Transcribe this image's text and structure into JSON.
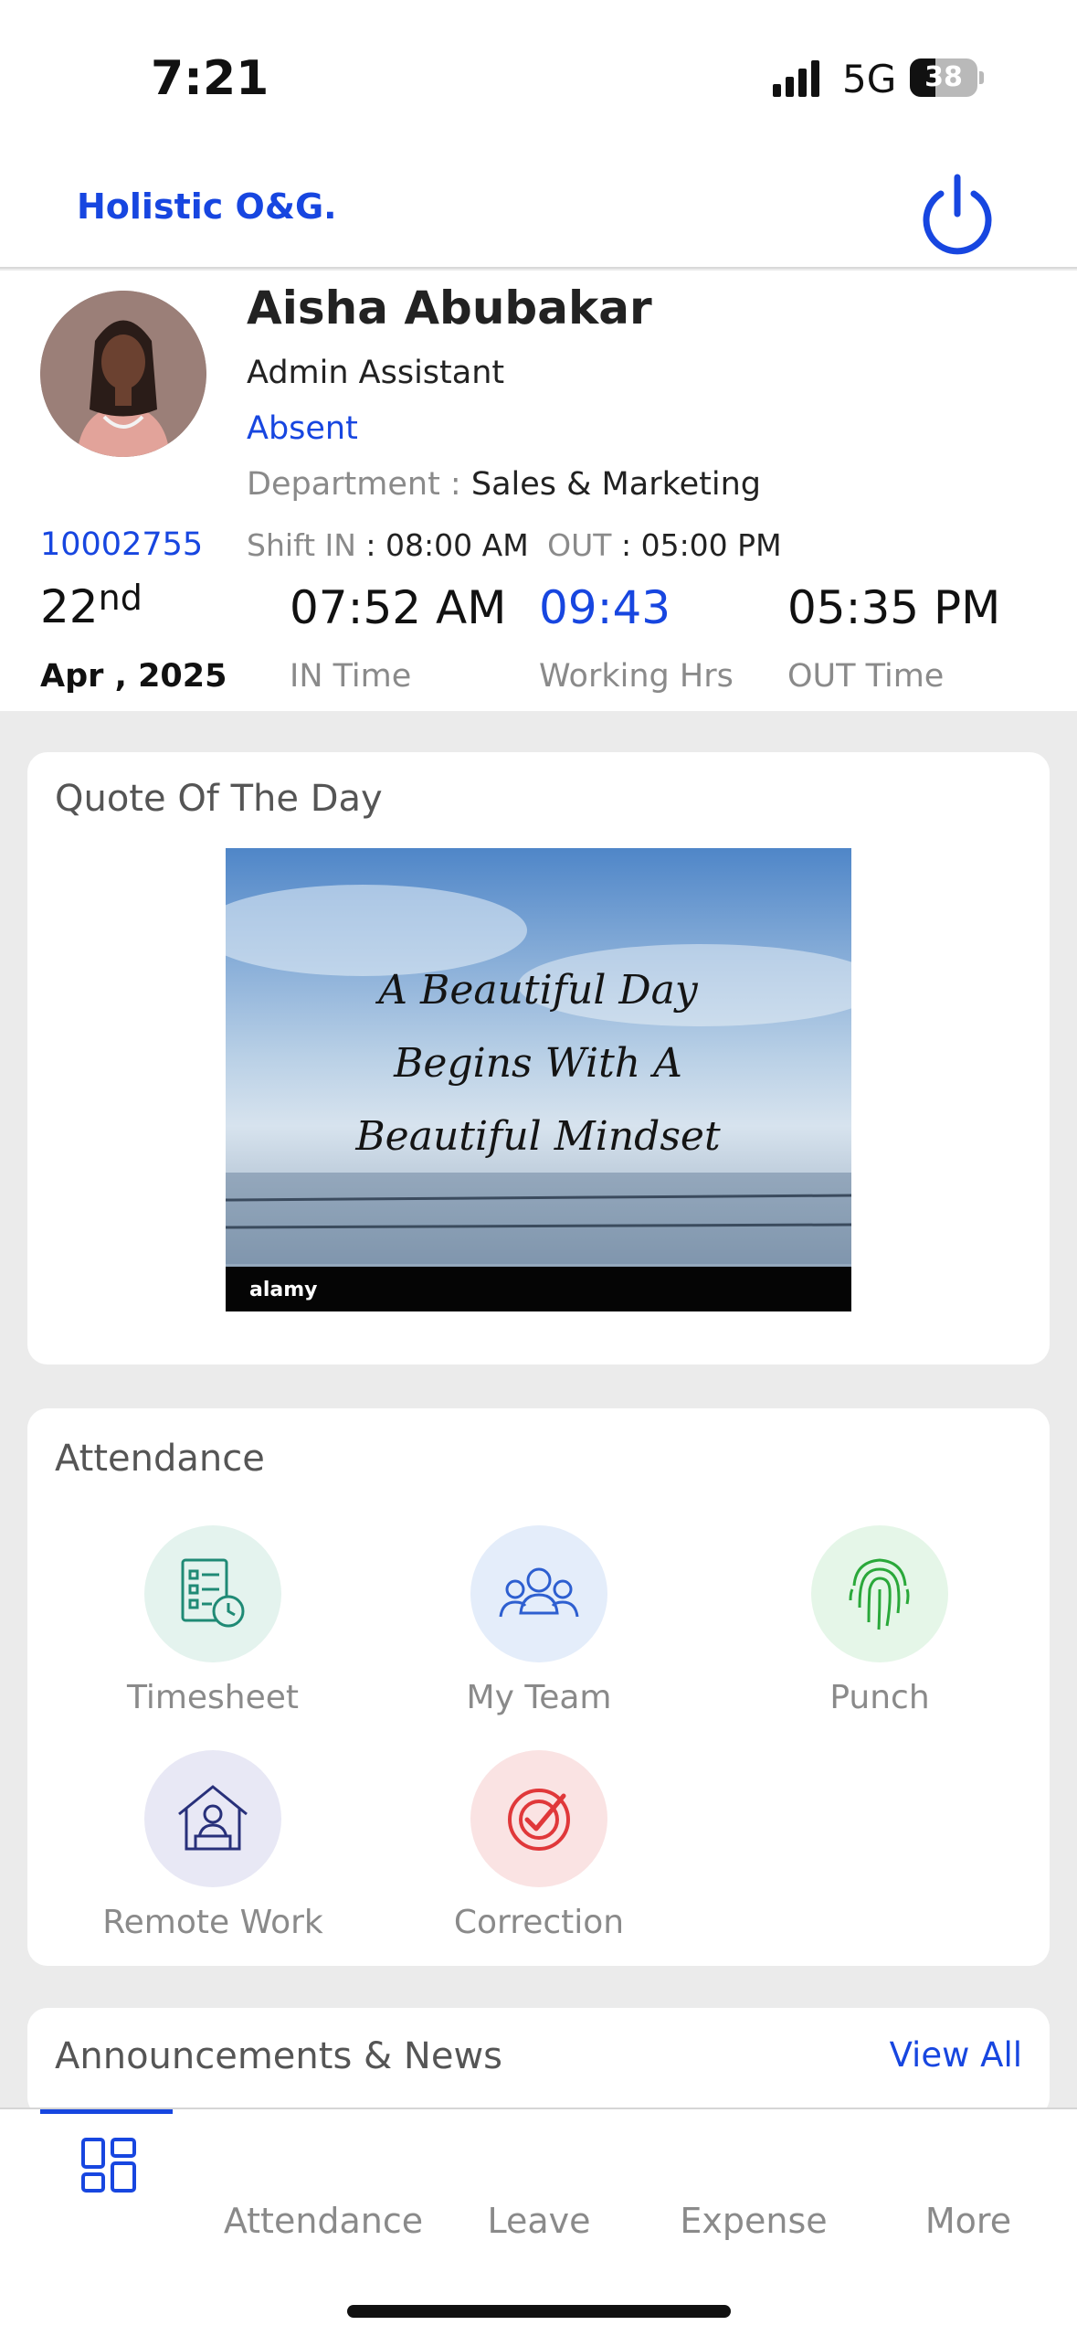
{
  "status_bar": {
    "time": "7:21",
    "network": "5G",
    "battery_level": "38"
  },
  "header": {
    "brand": "Holistic O&G."
  },
  "profile": {
    "name": "Aisha Abubakar",
    "role": "Admin Assistant",
    "status": "Absent",
    "department_label": "Department :",
    "department_value": "Sales & Marketing",
    "shift_in_label": "Shift IN",
    "shift_in_value": ": 08:00 AM",
    "shift_out_label": "OUT",
    "shift_out_value": ": 05:00 PM",
    "employee_id": "10002755",
    "date_day": "22",
    "date_suffix": "nd",
    "date_month": "Apr , 2025",
    "in_time": "07:52 AM",
    "in_time_label": "IN Time",
    "working_hrs": "09:43",
    "working_hrs_label": "Working Hrs",
    "out_time": "05:35 PM",
    "out_time_label": "OUT Time"
  },
  "quote": {
    "title": "Quote Of The Day",
    "line1": "A Beautiful Day",
    "line2": "Begins With A",
    "line3": "Beautiful Mindset",
    "watermark": "alamy"
  },
  "attendance": {
    "title": "Attendance",
    "tiles": [
      {
        "label": "Timesheet",
        "icon": "timesheet-icon"
      },
      {
        "label": "My Team",
        "icon": "team-icon"
      },
      {
        "label": "Punch",
        "icon": "fingerprint-icon"
      },
      {
        "label": "Remote Work",
        "icon": "remote-work-icon"
      },
      {
        "label": "Correction",
        "icon": "correction-icon"
      }
    ]
  },
  "news": {
    "title": "Announcements & News",
    "view_all": "View All"
  },
  "bottom_nav": {
    "items": [
      {
        "label": "",
        "icon": "dashboard-icon"
      },
      {
        "label": "Attendance"
      },
      {
        "label": "Leave"
      },
      {
        "label": "Expense"
      },
      {
        "label": "More"
      }
    ]
  },
  "colors": {
    "accent": "#1746e0",
    "muted": "#8a8a8a",
    "background": "#ebebeb"
  }
}
